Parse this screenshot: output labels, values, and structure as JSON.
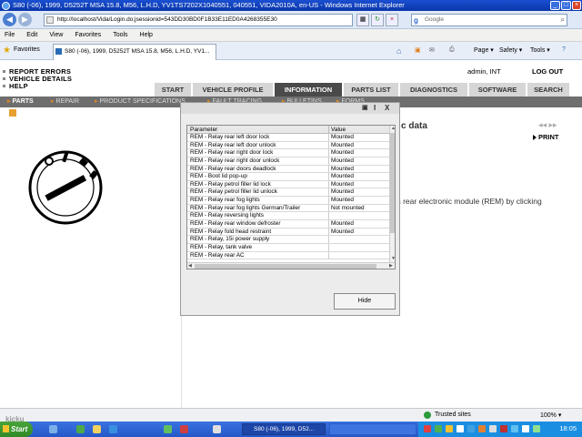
{
  "window": {
    "title": "S80 (-06), 1999, D5252T MSA 15.8, M56, L.H.D, YV1TS7202X1040551, 040551, VIDA2010A, en-US - Windows Internet Explorer"
  },
  "browser": {
    "address": "http://localhost/Vida/Login.do;jsessionid=543DD30BD0F1B33E11ED0A4268355E30",
    "search_placeholder": "Google",
    "menu": [
      "File",
      "Edit",
      "View",
      "Favorites",
      "Tools",
      "Help"
    ],
    "favorites_label": "Favorites",
    "tab_title": "S80 (-06), 1999, D5252T MSA 15.8, M56, L.H.D, YV1...",
    "toolbar_right": [
      "Page ▾",
      "Safety ▾",
      "Tools ▾"
    ]
  },
  "app": {
    "left_links": [
      "REPORT ERRORS",
      "VEHICLE DETAILS",
      "HELP"
    ],
    "user": "admin, INT",
    "logout": "LOG OUT",
    "main_tabs": [
      "START",
      "VEHICLE PROFILE",
      "INFORMATION",
      "PARTS LIST",
      "DIAGNOSTICS",
      "SOFTWARE",
      "SEARCH"
    ],
    "active_tab": "INFORMATION",
    "sub_tabs": [
      "PARTS",
      "REPAIR",
      "PRODUCT SPECIFICATIONS",
      "FAULT TRACING",
      "BULLETINS",
      "FORMS"
    ],
    "active_sub_tab": "PARTS",
    "content_title": "c data",
    "print_label": "PRINT",
    "nav_arrows": "◂◂  ▸▸",
    "body_text": "n rear electronic module (REM) by clicking"
  },
  "dialog": {
    "title_buttons": [
      "I",
      "X"
    ],
    "columns": [
      "Parameter",
      "Value"
    ],
    "rows": [
      [
        "REM - Relay rear left door lock",
        "Mounted"
      ],
      [
        "REM - Relay rear left door unlock",
        "Mounted"
      ],
      [
        "REM - Relay rear right door lock",
        "Mounted"
      ],
      [
        "REM - Relay rear right door unlock",
        "Mounted"
      ],
      [
        "REM - Relay rear doors deadlock",
        "Mounted"
      ],
      [
        "REM - Boot lid pop-up",
        "Mounted"
      ],
      [
        "REM - Relay petrol filler lid lock",
        "Mounted"
      ],
      [
        "REM - Relay petrol filler lid unlock",
        "Mounted"
      ],
      [
        "REM - Relay rear fog lights",
        "Mounted"
      ],
      [
        "REM - Relay rear fog lights German/Trailer",
        "Not mounted"
      ],
      [
        "REM - Relay reversing lights",
        ""
      ],
      [
        "REM - Relay rear window defroster",
        "Mounted"
      ],
      [
        "REM - Relay fold head restraint",
        "Mounted"
      ],
      [
        "REM - Relay, 15i power supply",
        ""
      ],
      [
        "REM - Relay, tank valve",
        ""
      ],
      [
        "REM - Relay rear AC",
        ""
      ]
    ],
    "hide_label": "Hide"
  },
  "status": {
    "zone": "Trusted sites",
    "zoom": "100% ▾"
  },
  "taskbar": {
    "start": "Start",
    "item": "S80 (-06), 1999, D52...",
    "clock": "18:05"
  },
  "watermark": "kicku"
}
